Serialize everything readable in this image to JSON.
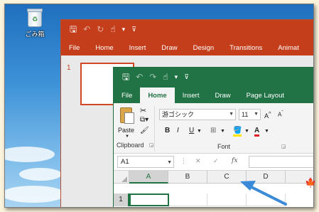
{
  "desktop": {
    "recycle_bin_label": "ごみ箱"
  },
  "powerpoint": {
    "qat": {
      "save": "🖫",
      "undo": "↶",
      "redo": "↻",
      "touch": "☝",
      "more": "▾",
      "customize": "⊽"
    },
    "tabs": [
      "File",
      "Home",
      "Insert",
      "Draw",
      "Design",
      "Transitions",
      "Animat"
    ],
    "slide_number": "1"
  },
  "excel": {
    "qat": {
      "save": "🖫",
      "undo": "↶",
      "redo": "↷",
      "touch": "☝",
      "more": "▾",
      "customize": "⊽"
    },
    "tabs": [
      "File",
      "Home",
      "Insert",
      "Draw",
      "Page Layout"
    ],
    "active_tab": "Home",
    "clipboard": {
      "paste_label": "Paste",
      "group_label": "Clipboard"
    },
    "font": {
      "font_name": "游ゴシック",
      "font_size": "11",
      "grow_label": "A",
      "shrink_label": "A",
      "bold": "B",
      "italic": "I",
      "underline": "U",
      "font_color_label": "A",
      "group_label": "Font"
    },
    "formula_bar": {
      "name_box": "A1",
      "cancel": "✕",
      "enter": "✓",
      "fx": "fx"
    },
    "columns": [
      "A",
      "B",
      "C",
      "D"
    ],
    "rows": [
      "1"
    ]
  },
  "colors": {
    "powerpoint_accent": "#c43e1c",
    "excel_accent": "#217346",
    "annotation_arrow": "#3a8ad8"
  }
}
